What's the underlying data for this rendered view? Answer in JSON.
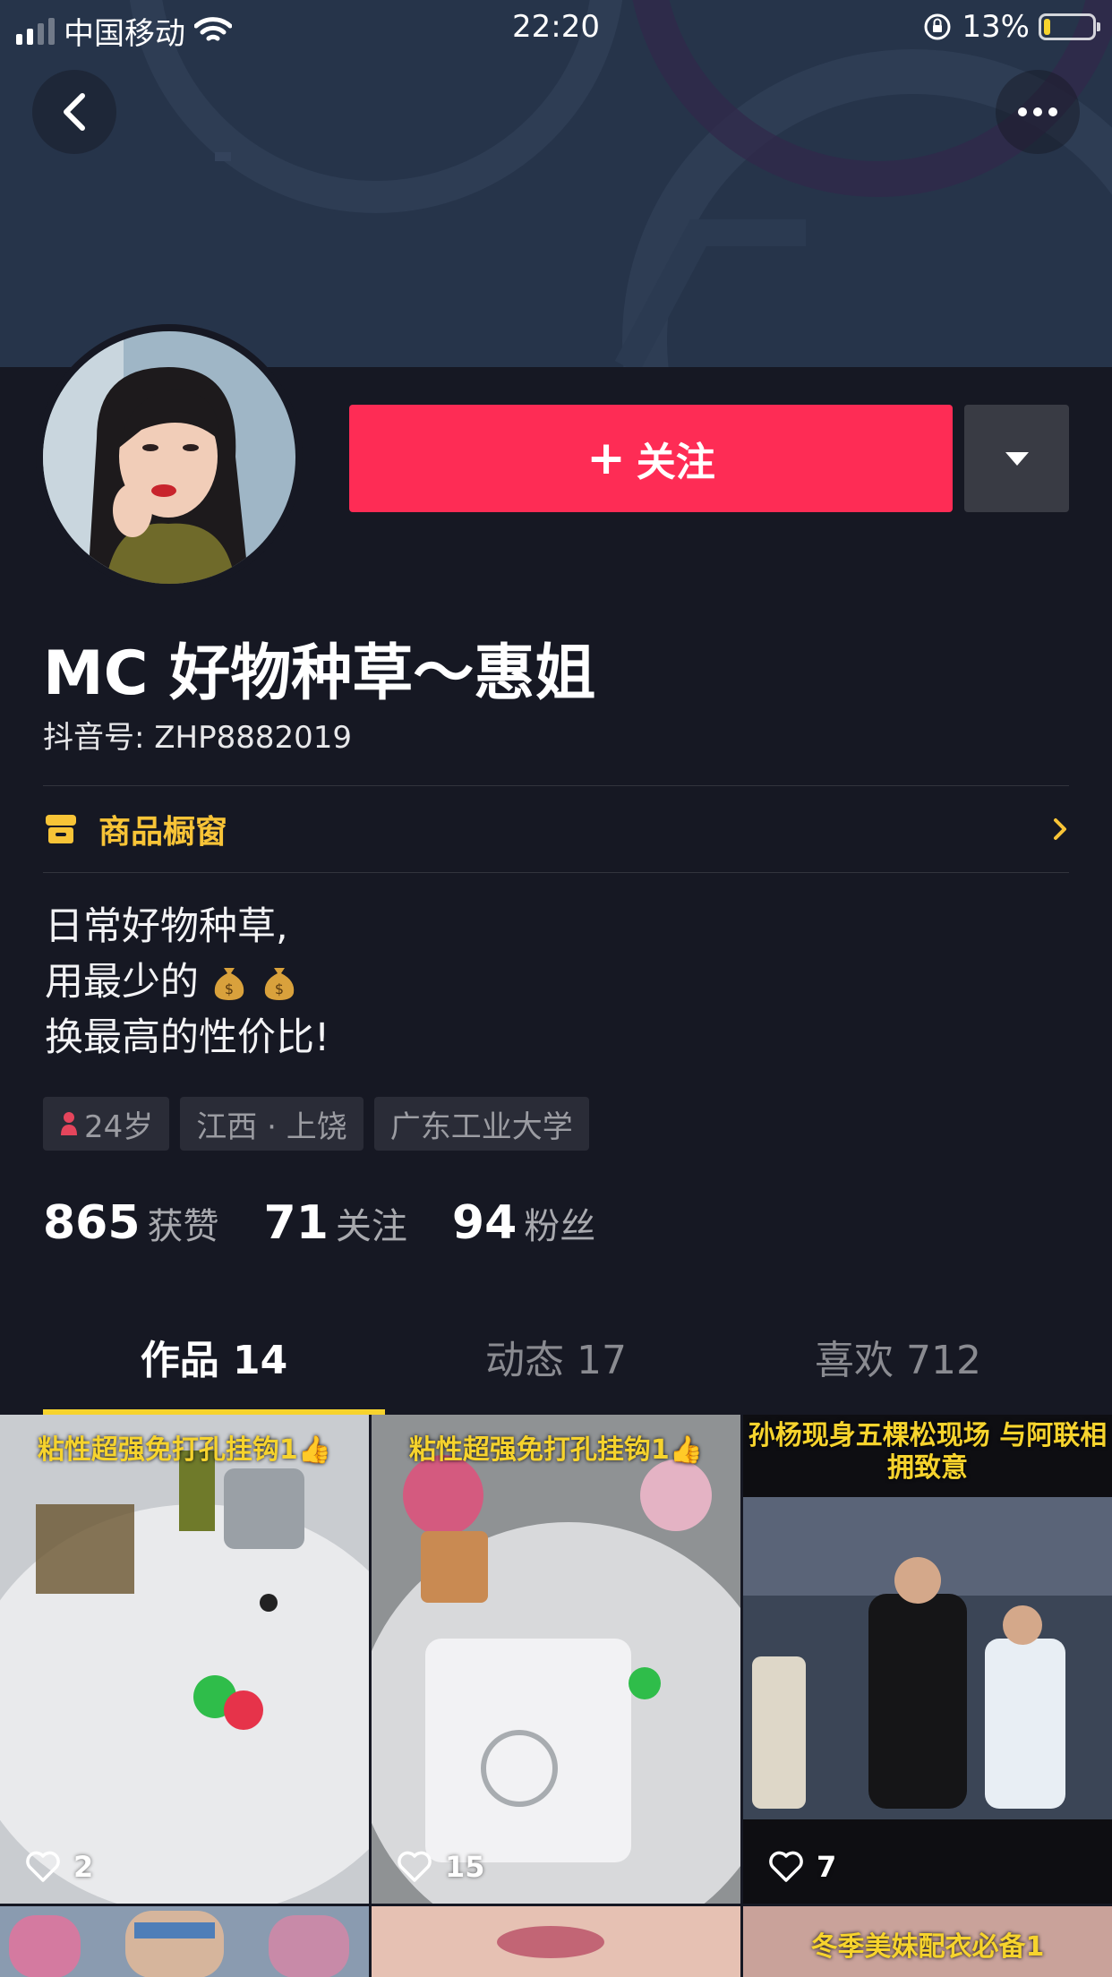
{
  "status_bar": {
    "carrier": "中国移动",
    "time": "22:20",
    "battery_percent": "13%",
    "battery_level": 0.13
  },
  "header": {
    "follow_label": "关注"
  },
  "profile": {
    "nickname": "MC 好物种草～惠姐",
    "douyin_id": "抖音号: ZHP8882019",
    "shop_label": "商品橱窗",
    "bio_line1": "日常好物种草,",
    "bio_line2": "用最少的",
    "bio_line3": "换最高的性价比!",
    "tags": [
      "24岁",
      "江西 · 上饶",
      "广东工业大学"
    ],
    "stats": [
      {
        "value": "865",
        "label": "获赞"
      },
      {
        "value": "71",
        "label": "关注"
      },
      {
        "value": "94",
        "label": "粉丝"
      }
    ]
  },
  "tabs": [
    {
      "label": "作品 14"
    },
    {
      "label": "动态 17"
    },
    {
      "label": "喜欢 712"
    }
  ],
  "videos": [
    {
      "title": "粘性超强免打孔挂钩1👍",
      "likes": "2"
    },
    {
      "title": "粘性超强免打孔挂钩1👍",
      "likes": "15"
    },
    {
      "title": "孙杨现身五棵松现场 与阿联相拥致意",
      "likes": "7"
    },
    {
      "title": "",
      "likes": ""
    },
    {
      "title": "",
      "likes": ""
    },
    {
      "title": "冬季美妹配衣必备1",
      "likes": ""
    }
  ],
  "colors": {
    "background": "#161823",
    "follow_button": "#fe2c55",
    "accent_yellow": "#f6d32d",
    "shop_text": "#f8c437"
  },
  "icons": [
    "back-arrow-icon",
    "more-dots-icon",
    "dropdown-triangle-icon",
    "shop-window-icon",
    "chevron-right-icon",
    "money-bag-icon",
    "female-person-icon",
    "heart-outline-icon",
    "wifi-icon",
    "rotation-lock-icon"
  ]
}
